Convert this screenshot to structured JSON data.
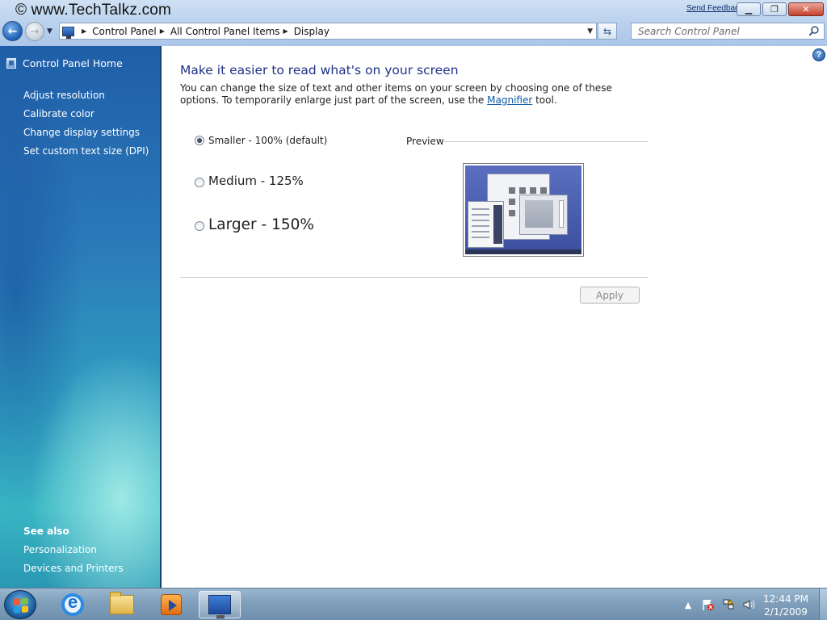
{
  "watermark": "© www.TechTalkz.com",
  "titlebar": {
    "send_feedback": "Send Feedback",
    "minimize_icon": "minimize-icon",
    "maximize_icon": "restore-icon",
    "close_icon": "close-icon"
  },
  "address_bar": {
    "breadcrumbs": [
      "Control Panel",
      "All Control Panel Items",
      "Display"
    ]
  },
  "search": {
    "placeholder": "Search Control Panel"
  },
  "sidebar": {
    "home_label": "Control Panel Home",
    "links": [
      "Adjust resolution",
      "Calibrate color",
      "Change display settings",
      "Set custom text size (DPI)"
    ],
    "see_also_title": "See also",
    "see_also_links": [
      "Personalization",
      "Devices and Printers"
    ]
  },
  "main": {
    "heading": "Make it easier to read what's on your screen",
    "description_before": "You can change the size of text and other items on your screen by choosing one of these options. To temporarily enlarge just part of the screen, use the ",
    "description_link": "Magnifier",
    "description_after": " tool.",
    "options": [
      {
        "label": "Smaller - 100% (default)",
        "checked": true
      },
      {
        "label": "Medium - 125%",
        "checked": false
      },
      {
        "label": "Larger - 150%",
        "checked": false
      }
    ],
    "preview_label": "Preview",
    "apply_label": "Apply",
    "apply_enabled": false
  },
  "taskbar": {
    "pinned": [
      "Internet Explorer",
      "Windows Explorer",
      "Windows Media Player",
      "Control Panel"
    ],
    "active": "Control Panel",
    "tray_icons": [
      "show-hidden-icons-icon",
      "action-center-icon",
      "network-icon",
      "volume-icon"
    ],
    "time": "12:44 PM",
    "date": "2/1/2009"
  },
  "colors": {
    "heading": "#1e3287",
    "link": "#0d5aa7",
    "sidebar_top": "#1f5ea8",
    "sidebar_bottom": "#39b7c4"
  }
}
